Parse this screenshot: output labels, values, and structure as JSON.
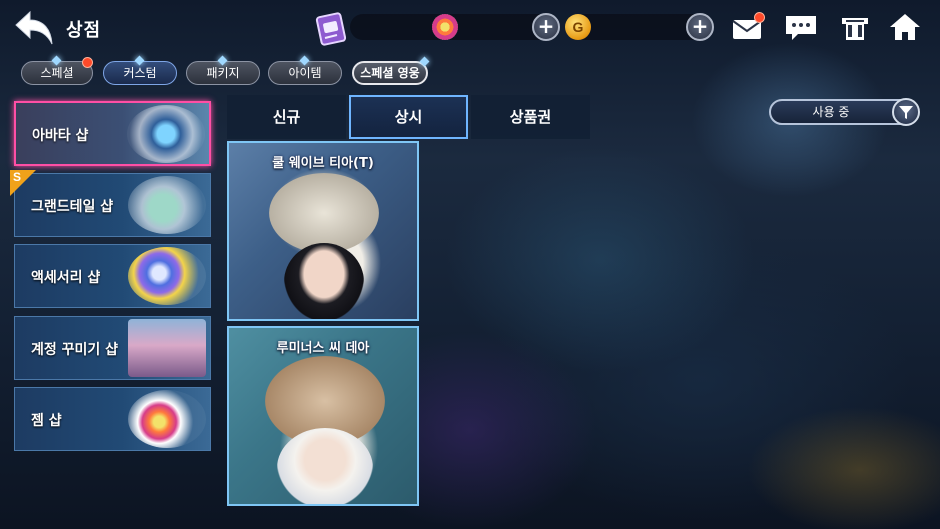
{
  "header": {
    "title": "상점",
    "gold_symbol": "G",
    "icons": [
      "back-arrow-icon",
      "ticket-icon",
      "gem-icon",
      "gold-coin-icon",
      "plus-icon",
      "mail-icon",
      "chat-icon",
      "closet-icon",
      "home-icon"
    ]
  },
  "category_tabs": [
    {
      "label": "스페셜",
      "has_new": true
    },
    {
      "label": "커스텀",
      "selected": true
    },
    {
      "label": "패키지"
    },
    {
      "label": "아이템"
    },
    {
      "label": "스페셜 영웅"
    }
  ],
  "sidebar": {
    "items": [
      {
        "label": "아바타 샵",
        "selected": true
      },
      {
        "label": "그랜드테일 샵",
        "badge": "S"
      },
      {
        "label": "액세서리 샵"
      },
      {
        "label": "계정 꾸미기 샵"
      },
      {
        "label": "젬 샵"
      }
    ]
  },
  "sub_tabs": [
    {
      "label": "신규"
    },
    {
      "label": "상시",
      "selected": true
    },
    {
      "label": "상품권"
    }
  ],
  "filter": {
    "label": "사용 중"
  },
  "products": [
    {
      "name": "쿨 웨이브 티아(T)"
    },
    {
      "name": "루미너스 씨 데아"
    }
  ],
  "colors": {
    "accent_pink": "#ff4fa5",
    "accent_blue": "#6fb5ff",
    "notification_red": "#ff4a2a",
    "gold": "#e79a14"
  }
}
